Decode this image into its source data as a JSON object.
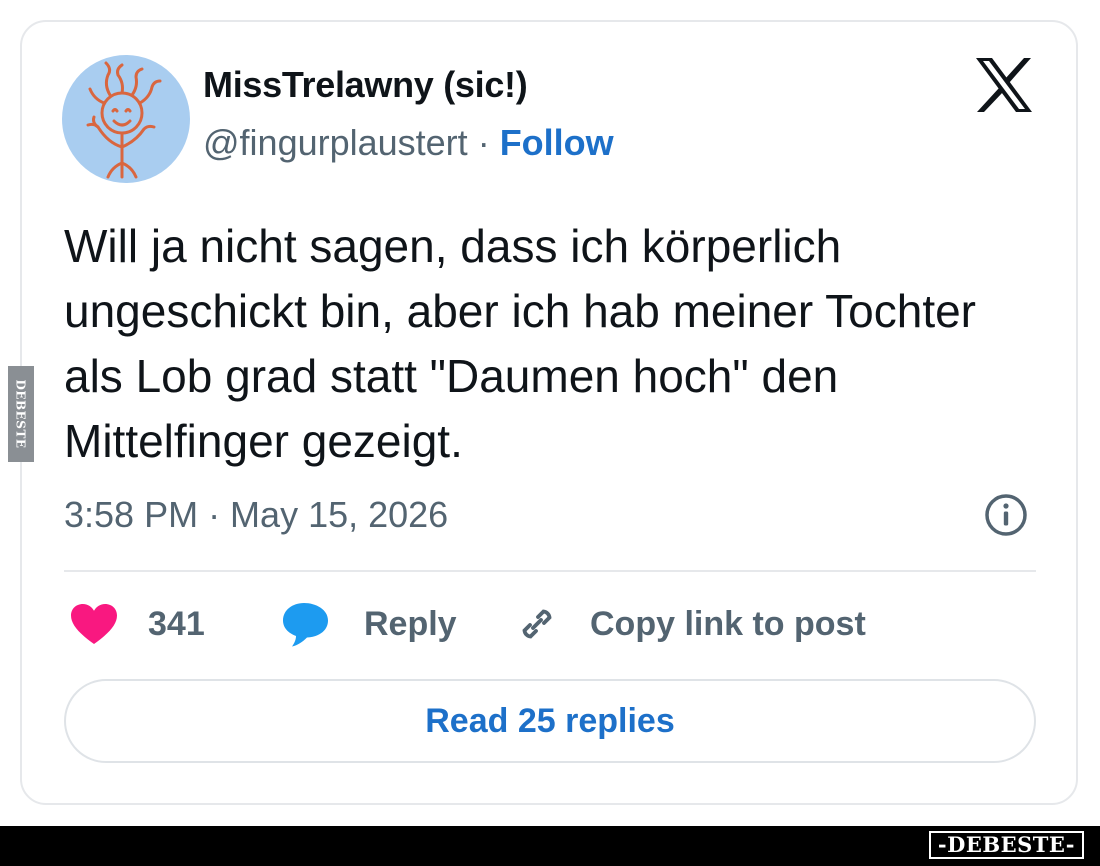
{
  "tweet": {
    "display_name": "MissTrelawny (sic!)",
    "handle": "@fingurplaustert",
    "separator": " · ",
    "follow_label": "Follow",
    "text": "Will ja nicht sagen, dass ich körperlich ungeschickt bin, aber ich hab meiner Tochter als Lob grad statt \"Daumen hoch\" den Mittelfinger gezeigt.",
    "timestamp": "3:58 PM · May 15, 2026",
    "platform_icon": "x-logo-icon"
  },
  "actions": {
    "like_count": "341",
    "like_icon": "heart-icon",
    "reply_label": "Reply",
    "reply_icon": "speech-bubble-icon",
    "copy_label": "Copy link to post",
    "copy_icon": "link-icon",
    "info_icon": "info-icon"
  },
  "read_replies_label": "Read 25 replies",
  "watermark": {
    "side_text": "DEBESTE",
    "footer_text": "-DEBESTE-"
  },
  "colors": {
    "accent_blue": "#1d70c9",
    "heart_pink": "#f91880",
    "reply_blue": "#1d9bf0",
    "text_primary": "#0f1419",
    "text_secondary": "#536471"
  }
}
